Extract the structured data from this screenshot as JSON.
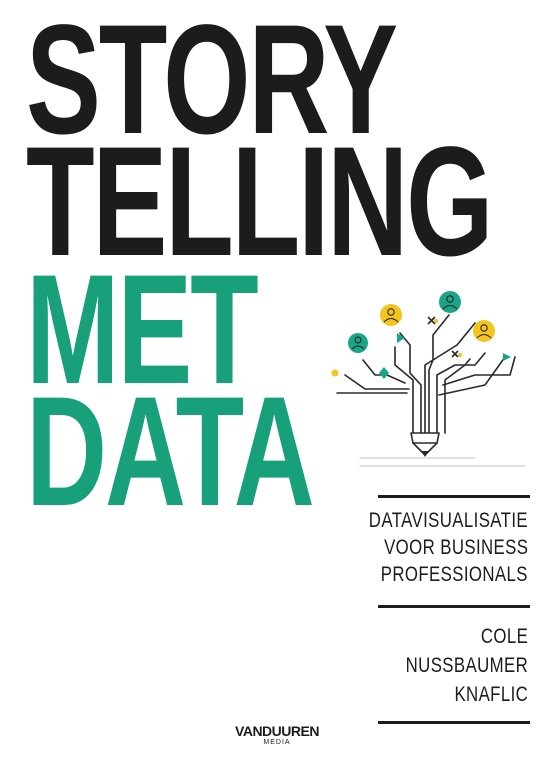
{
  "title": {
    "line1": "STORY",
    "line2": "TELLING",
    "line3": "MET",
    "line4": "DATA"
  },
  "subtitle": {
    "line1": "DATAVISUALISATIE",
    "line2": "VOOR BUSINESS",
    "line3": "PROFESSIONALS"
  },
  "author": {
    "line1": "COLE",
    "line2": "NUSSBAUMER",
    "line3": "KNAFLIC"
  },
  "publisher": {
    "name": "VANDUUREN",
    "sub": "MEDIA"
  },
  "colors": {
    "title_dark": "#1c1c1c",
    "title_green": "#17a07a",
    "accent_yellow": "#f2c41c",
    "accent_teal": "#1aa686"
  },
  "illustration": "pencil-tree-illustration"
}
